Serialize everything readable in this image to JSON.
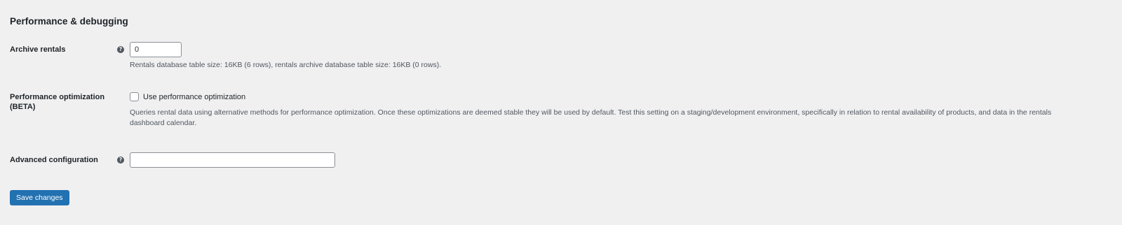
{
  "section": {
    "title": "Performance & debugging"
  },
  "archive": {
    "label": "Archive rentals",
    "help_icon": "question-icon",
    "value": "0",
    "description": "Rentals database table size: 16KB (6 rows), rentals archive database table size: 16KB (0 rows)."
  },
  "performance": {
    "label": "Performance optimization (BETA)",
    "checkbox_label": "Use performance optimization",
    "checked": false,
    "description": "Queries rental data using alternative methods for performance optimization. Once these optimizations are deemed stable they will be used by default. Test this setting on a staging/development environment, specifically in relation to rental availability of products, and data in the rentals dashboard calendar."
  },
  "advanced": {
    "label": "Advanced configuration",
    "help_icon": "question-icon",
    "value": ""
  },
  "actions": {
    "save_label": "Save changes"
  },
  "colors": {
    "background": "#f0f0f1",
    "primary_button": "#2271b1",
    "text": "#1d2327",
    "muted_text": "#50575e"
  }
}
